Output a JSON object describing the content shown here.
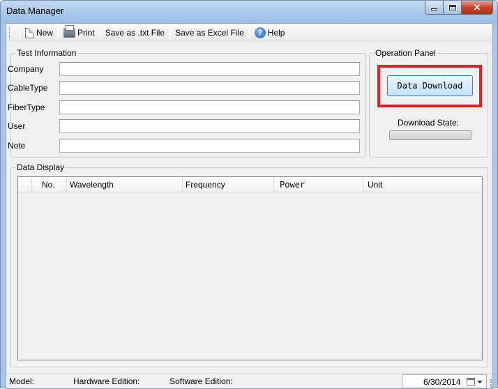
{
  "window": {
    "title": "Data Manager"
  },
  "toolbar": {
    "new_label": "New",
    "print_label": "Print",
    "save_txt_label": "Save as .txt File",
    "save_excel_label": "Save as Excel File",
    "help_label": "Help",
    "help_icon_glyph": "?"
  },
  "test_information": {
    "legend": "Test Information",
    "fields": [
      {
        "label": "Company",
        "value": ""
      },
      {
        "label": "CableType",
        "value": ""
      },
      {
        "label": "FiberType",
        "value": ""
      },
      {
        "label": "User",
        "value": ""
      },
      {
        "label": "Note",
        "value": ""
      }
    ]
  },
  "operation_panel": {
    "legend": "Operation Panel",
    "download_button": "Data Download",
    "download_state_label": "Download State:",
    "download_progress": 0,
    "highlight_color": "#e0202a"
  },
  "data_display": {
    "legend": "Data Display",
    "columns": [
      "",
      "No.",
      "Wavelength",
      "Frequency",
      "Power",
      "Unit"
    ],
    "rows": []
  },
  "status_bar": {
    "model_label": "Model:",
    "hardware_label": "Hardware Edition:",
    "software_label": "Software Edition:",
    "date": "6/30/2014"
  }
}
